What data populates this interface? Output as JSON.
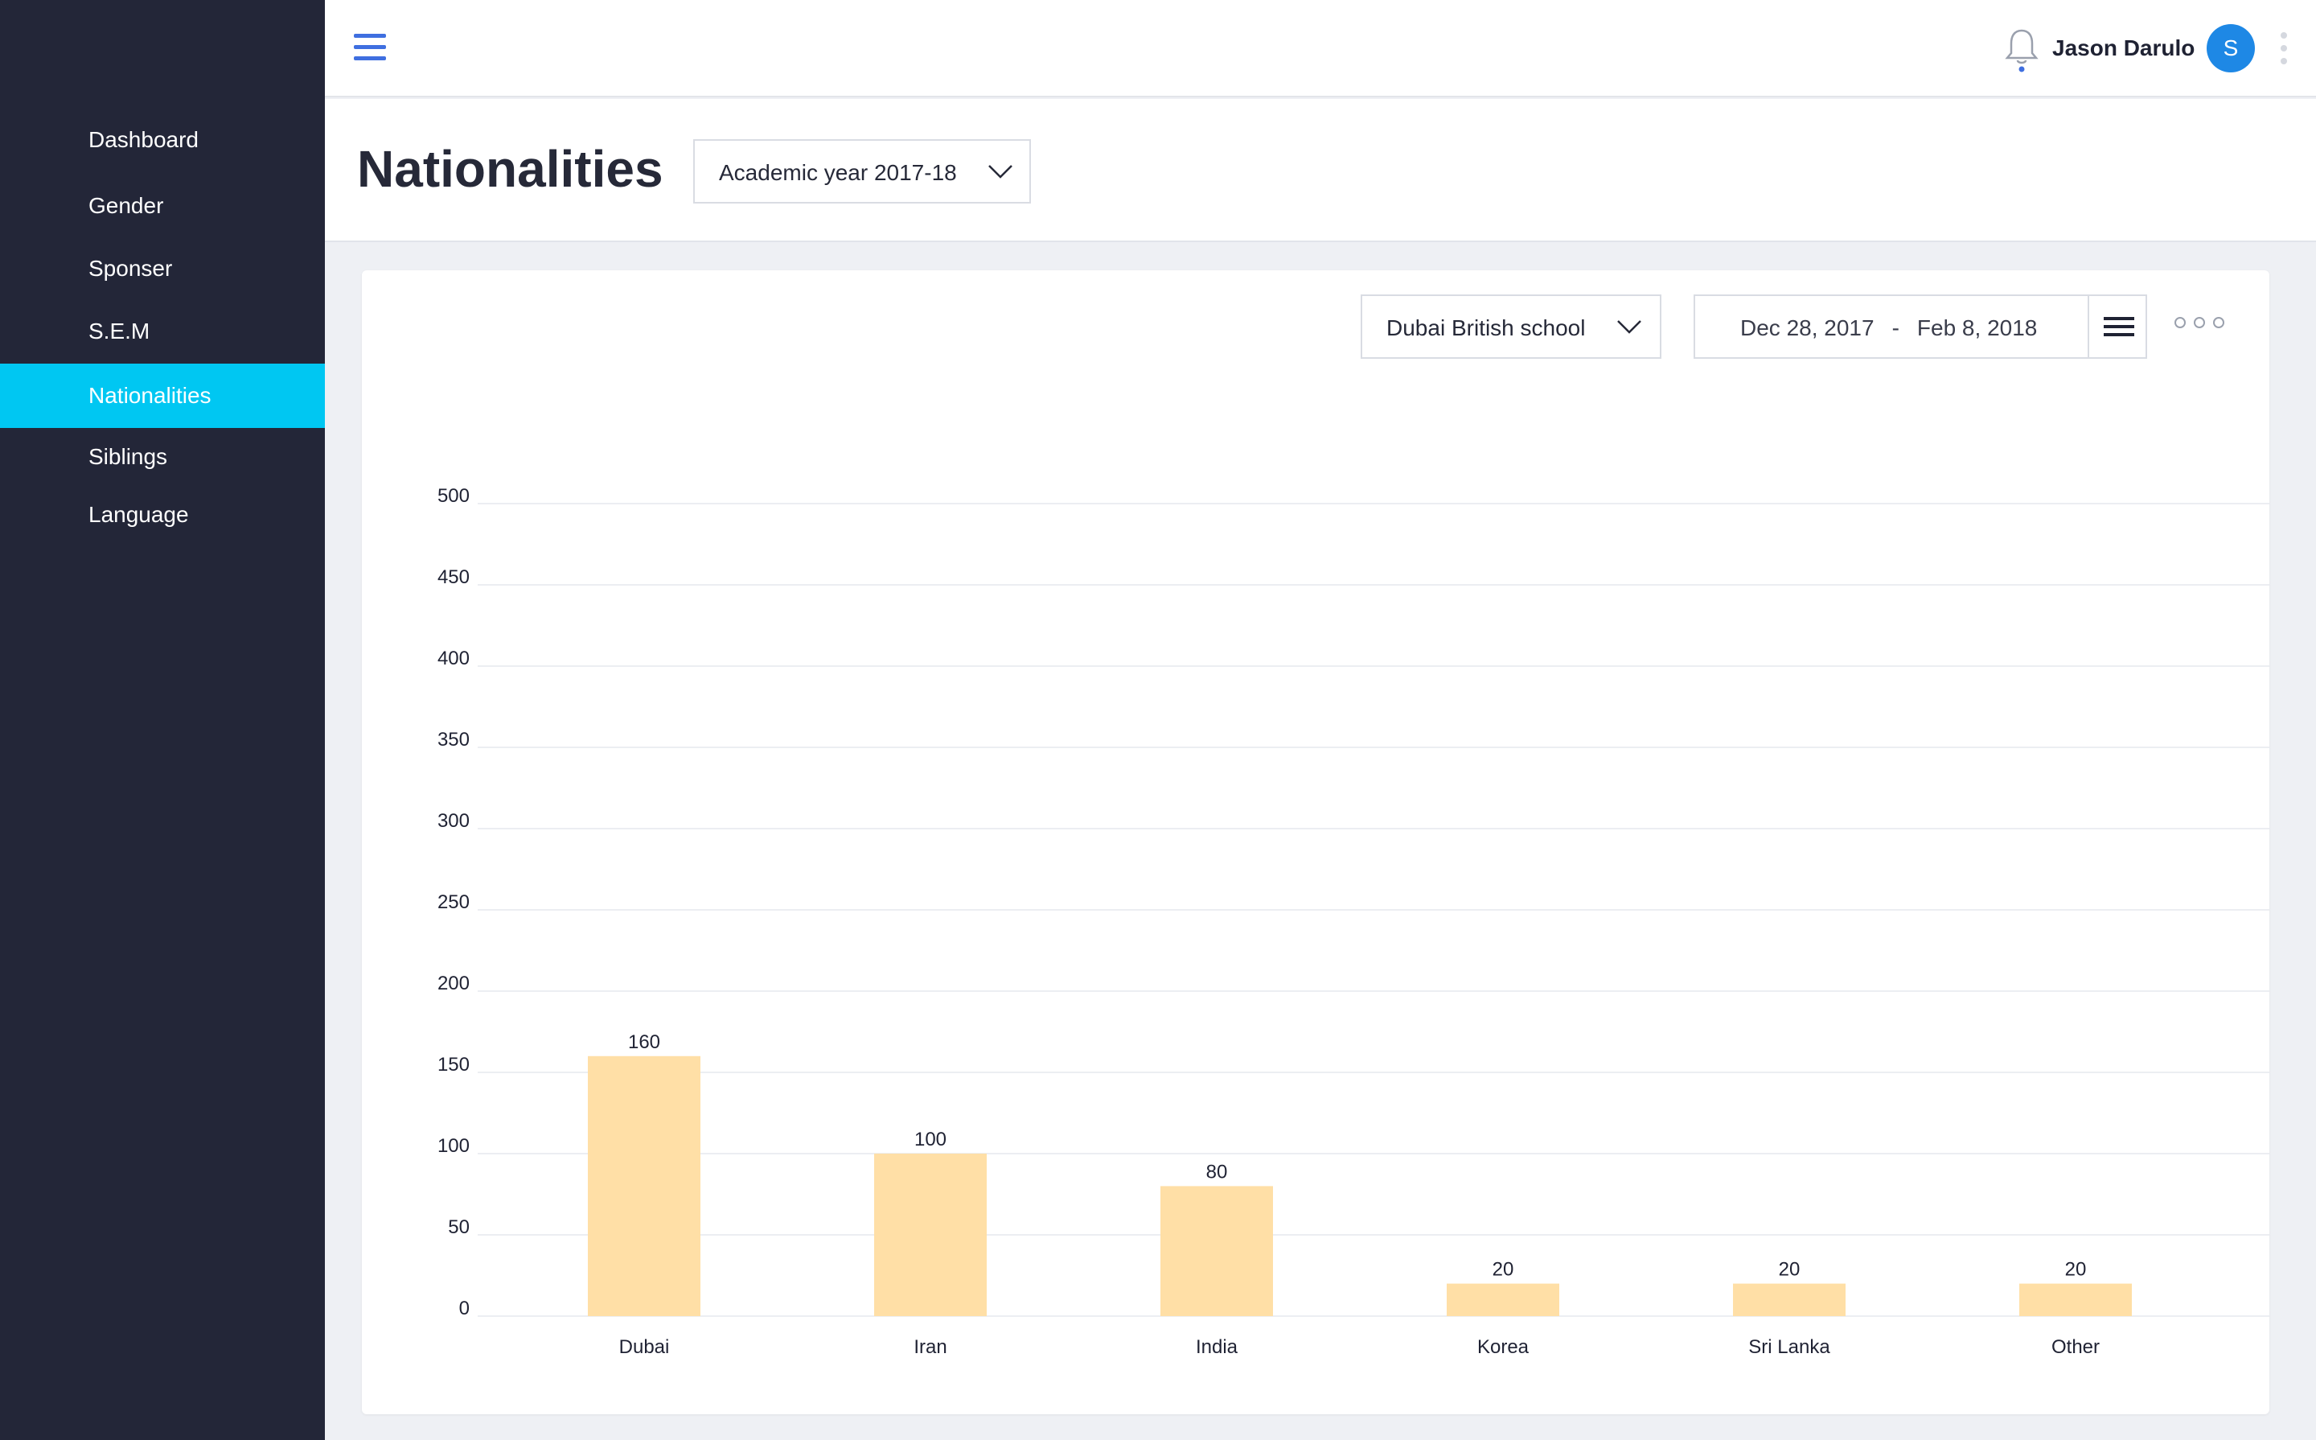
{
  "sidebar": {
    "items": [
      {
        "label": "Dashboard",
        "active": false
      },
      {
        "label": "Gender",
        "active": false
      },
      {
        "label": "Sponser",
        "active": false
      },
      {
        "label": "S.E.M",
        "active": false
      },
      {
        "label": "Nationalities",
        "active": true
      },
      {
        "label": "Siblings",
        "active": false
      },
      {
        "label": "Language",
        "active": false
      }
    ]
  },
  "topbar": {
    "menu_icon": "hamburger-icon",
    "notification_icon": "bell-icon",
    "user_name": "Jason Darulo",
    "avatar_initial": "S",
    "overflow_icon": "vertical-dots-icon"
  },
  "header": {
    "title": "Nationalities",
    "year_select": "Academic year 2017-18"
  },
  "filters": {
    "school_select": "Dubai British school",
    "date_start": "Dec 28, 2017",
    "date_separator": "-",
    "date_end": "Feb 8, 2018",
    "date_menu_icon": "hamburger-icon",
    "more_icon": "horizontal-dots-icon"
  },
  "colors": {
    "sidebar_bg": "#232638",
    "active_item": "#00c7f2",
    "bar_fill": "#ffdfa6",
    "accent": "#3f6fe0"
  },
  "chart_data": {
    "type": "bar",
    "categories": [
      "Dubai",
      "Iran",
      "India",
      "Korea",
      "Sri Lanka",
      "Other"
    ],
    "values": [
      160,
      100,
      80,
      20,
      20,
      20
    ],
    "data_labels": [
      "160",
      "100",
      "80",
      "20",
      "20",
      "20"
    ],
    "yticks": [
      0,
      50,
      100,
      150,
      200,
      250,
      300,
      350,
      400,
      450,
      500
    ],
    "ylim": [
      0,
      500
    ],
    "grid": true,
    "legend": "none"
  }
}
